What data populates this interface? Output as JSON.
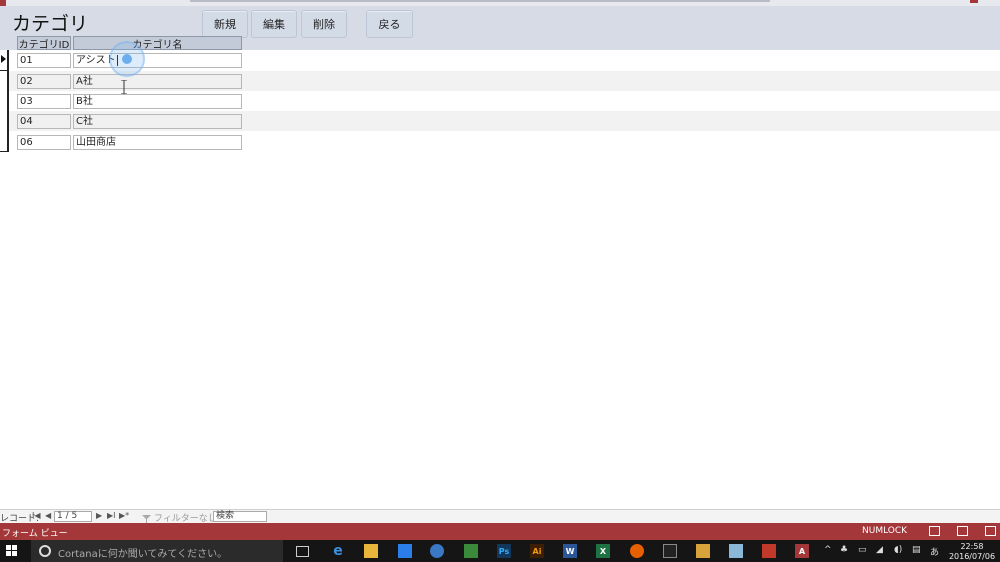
{
  "window": {
    "title": ""
  },
  "form": {
    "title": "カテゴリ",
    "buttons": {
      "new": "新規",
      "edit": "編集",
      "delete": "削除",
      "back": "戻る"
    },
    "columns": {
      "id": "カテゴリID",
      "name": "カテゴリ名"
    },
    "rows": [
      {
        "id": "01",
        "name": "アシスト"
      },
      {
        "id": "02",
        "name": "A社"
      },
      {
        "id": "03",
        "name": "B社"
      },
      {
        "id": "04",
        "name": "C社"
      },
      {
        "id": "06",
        "name": "山田商店"
      }
    ]
  },
  "navigation": {
    "label": "レコード:",
    "first": "I◀",
    "prev": "◀",
    "record": "1 / 5",
    "next": "▶",
    "last": "▶I",
    "new": "▶*",
    "filter": "フィルターなし",
    "search_placeholder": "検索"
  },
  "status": {
    "view": "フォーム ビュー",
    "numlock": "NUMLOCK"
  },
  "taskbar": {
    "cortana_placeholder": "Cortanaに何か聞いてみてください。",
    "apps": {
      "ps": "Ps",
      "ai": "Ai",
      "word": "W",
      "excel": "X",
      "access": "A"
    },
    "tray": {
      "ime": "あ"
    },
    "time": "22:58",
    "date": "2016/07/06"
  },
  "colors": {
    "header": "#d6dbe6",
    "button": "#d3dbe7",
    "status": "#a4373a",
    "taskbar": "#151515"
  }
}
